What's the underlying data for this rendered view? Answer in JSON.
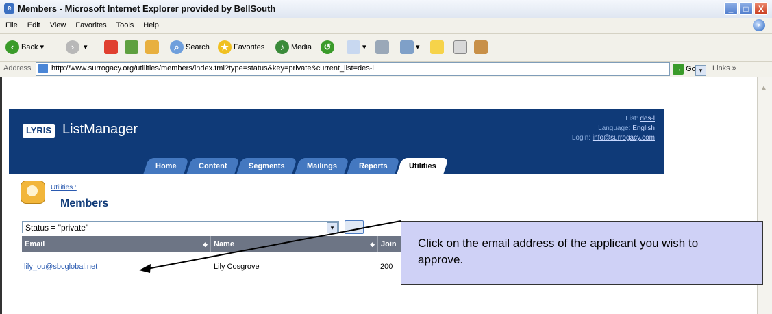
{
  "window": {
    "title": "Members - Microsoft Internet Explorer provided by BellSouth",
    "min": "_",
    "max": "□",
    "close": "X"
  },
  "menu": [
    "File",
    "Edit",
    "View",
    "Favorites",
    "Tools",
    "Help"
  ],
  "toolbar": {
    "back": "Back",
    "search": "Search",
    "favorites": "Favorites",
    "media": "Media"
  },
  "address": {
    "label": "Address",
    "url": "http://www.surrogacy.org/utilities/members/index.tml?type=status&key=private&current_list=des-l",
    "go": "Go",
    "links": "Links »"
  },
  "lyris": {
    "badge": "LYRIS",
    "product": "ListManager",
    "list_label": "List:",
    "list_value": "des-l",
    "language_label": "Language:",
    "language_value": "English",
    "login_label": "Login:",
    "login_value": "info@surrogacy.com",
    "tabs": [
      "Home",
      "Content",
      "Segments",
      "Mailings",
      "Reports",
      "Utilities"
    ],
    "active_tab": "Utilities"
  },
  "page": {
    "crumb": "Utilities :",
    "title": "Members"
  },
  "filter": {
    "value": "Status = \"private\""
  },
  "table": {
    "headers": [
      "Email",
      "Name",
      "Join"
    ],
    "rows": [
      {
        "email": "lily_ou@sbcglobal.net",
        "name": "Lily Cosgrove",
        "join": "200"
      }
    ]
  },
  "callout": {
    "text": "Click on the email address of the applicant you wish to approve.",
    "arrow_color": "#000000"
  },
  "colors": {
    "lyris_header": "#0f3a78",
    "tab": "#4478c0",
    "callout_bg": "#cfd1f6"
  }
}
